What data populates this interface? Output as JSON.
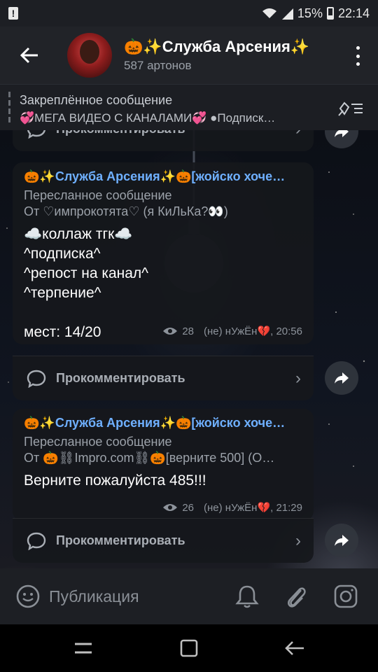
{
  "status": {
    "battery": "15%",
    "time": "22:14"
  },
  "header": {
    "title": "🎃✨Служба Арсения✨",
    "subtitle": "587 артонов"
  },
  "pinned": {
    "title": "Закреплённое сообщение",
    "text": "💞МЕГА ВИДЕО С КАНАЛАМИ💞 ●Подписк…"
  },
  "top_comment": {
    "label": "Прокомментировать"
  },
  "messages": [
    {
      "channel": "🎃✨Служба Арсения✨🎃[жойско хоче…",
      "forwarded_label": "Пересланное сообщение",
      "from": "От ♡импрокотята♡ (я КиЛьКа?👀)",
      "lines": [
        "☁️коллаж тгк☁️",
        "^подписка^",
        "^репост на канал^",
        "^терпение^",
        "",
        "мест: 14/20"
      ],
      "views": "28",
      "author": "(не) нУжЁн💔, 20:56",
      "comment": "Прокомментировать"
    },
    {
      "channel": "🎃✨Служба Арсения✨🎃[жойско хоче…",
      "forwarded_label": "Пересланное сообщение",
      "from": "От 🎃⛓Impro.com⛓🎃[верните 500] (О…",
      "lines": [
        "Верните пожалуйста 485!!!"
      ],
      "views": "26",
      "author": "(не) нУжЁн💔, 21:29",
      "comment": "Прокомментировать"
    }
  ],
  "composer": {
    "placeholder": "Публикация"
  }
}
